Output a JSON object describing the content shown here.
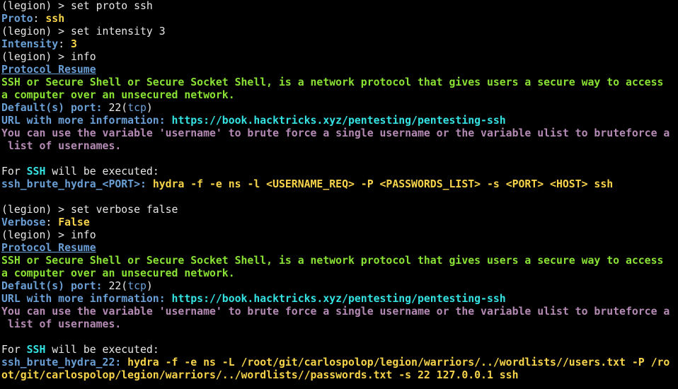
{
  "colors": {
    "background": "#000000",
    "foreground": "#e8e8e8",
    "blue": "#6a9fd6",
    "yellow": "#f7d44a",
    "green": "#8ae234",
    "cyan": "#34e2e2",
    "magenta": "#b58bb5"
  },
  "lines": [
    {
      "segments": [
        {
          "text": "(legion) > set proto ssh",
          "cls": "p-prompt"
        }
      ]
    },
    {
      "segments": [
        {
          "text": "Proto",
          "cls": "blue-b"
        },
        {
          "text": ": ",
          "cls": "white"
        },
        {
          "text": "ssh",
          "cls": "yellow-b"
        }
      ]
    },
    {
      "segments": [
        {
          "text": "(legion) > set intensity 3",
          "cls": "p-prompt"
        }
      ]
    },
    {
      "segments": [
        {
          "text": "Intensity",
          "cls": "blue-b"
        },
        {
          "text": ": ",
          "cls": "white"
        },
        {
          "text": "3",
          "cls": "yellow-b"
        }
      ]
    },
    {
      "segments": [
        {
          "text": "(legion) > info",
          "cls": "p-prompt"
        }
      ]
    },
    {
      "segments": [
        {
          "text": "Protocol Resume",
          "cls": "blue-b underline"
        }
      ]
    },
    {
      "segments": [
        {
          "text": "SSH or Secure Shell or Secure Socket Shell, is a network protocol that gives users a secure way to access",
          "cls": "green-b"
        }
      ]
    },
    {
      "segments": [
        {
          "text": "a computer over an unsecured network.",
          "cls": "green-b"
        }
      ]
    },
    {
      "segments": [
        {
          "text": "Default(s) port:",
          "cls": "blue-b"
        },
        {
          "text": " 22(",
          "cls": "white"
        },
        {
          "text": "tcp",
          "cls": "blue"
        },
        {
          "text": ")",
          "cls": "white"
        }
      ]
    },
    {
      "segments": [
        {
          "text": "URL with more information:",
          "cls": "blue-b"
        },
        {
          "text": " https://book.hacktricks.xyz/pentesting/pentesting-ssh",
          "cls": "cyan-b"
        }
      ]
    },
    {
      "segments": [
        {
          "text": "You can use the variable 'username' to brute force a single username or the variable ulist to bruteforce a",
          "cls": "magenta-b"
        }
      ]
    },
    {
      "segments": [
        {
          "text": " list of usernames.",
          "cls": "magenta-b"
        }
      ]
    },
    {
      "segments": [
        {
          "text": "",
          "cls": "white"
        }
      ]
    },
    {
      "segments": [
        {
          "text": "For ",
          "cls": "white"
        },
        {
          "text": "SSH",
          "cls": "cyan-b"
        },
        {
          "text": " will be executed:",
          "cls": "white"
        }
      ]
    },
    {
      "segments": [
        {
          "text": "ssh_brute_hydra_<PORT>:",
          "cls": "blue-b"
        },
        {
          "text": " hydra -f -e ns -l <USERNAME_REQ> -P <PASSWORDS_LIST> -s <PORT> <HOST> ssh",
          "cls": "yellow-b"
        }
      ]
    },
    {
      "segments": [
        {
          "text": "",
          "cls": "white"
        }
      ]
    },
    {
      "segments": [
        {
          "text": "(legion) > set verbose false",
          "cls": "p-prompt"
        }
      ]
    },
    {
      "segments": [
        {
          "text": "Verbose",
          "cls": "blue-b"
        },
        {
          "text": ": ",
          "cls": "white"
        },
        {
          "text": "False",
          "cls": "yellow-b"
        }
      ]
    },
    {
      "segments": [
        {
          "text": "(legion) > info",
          "cls": "p-prompt"
        }
      ]
    },
    {
      "segments": [
        {
          "text": "Protocol Resume",
          "cls": "blue-b underline"
        }
      ]
    },
    {
      "segments": [
        {
          "text": "SSH or Secure Shell or Secure Socket Shell, is a network protocol that gives users a secure way to access",
          "cls": "green-b"
        }
      ]
    },
    {
      "segments": [
        {
          "text": "a computer over an unsecured network.",
          "cls": "green-b"
        }
      ]
    },
    {
      "segments": [
        {
          "text": "Default(s) port:",
          "cls": "blue-b"
        },
        {
          "text": " 22(",
          "cls": "white"
        },
        {
          "text": "tcp",
          "cls": "blue"
        },
        {
          "text": ")",
          "cls": "white"
        }
      ]
    },
    {
      "segments": [
        {
          "text": "URL with more information:",
          "cls": "blue-b"
        },
        {
          "text": " https://book.hacktricks.xyz/pentesting/pentesting-ssh",
          "cls": "cyan-b"
        }
      ]
    },
    {
      "segments": [
        {
          "text": "You can use the variable 'username' to brute force a single username or the variable ulist to bruteforce a",
          "cls": "magenta-b"
        }
      ]
    },
    {
      "segments": [
        {
          "text": " list of usernames.",
          "cls": "magenta-b"
        }
      ]
    },
    {
      "segments": [
        {
          "text": "",
          "cls": "white"
        }
      ]
    },
    {
      "segments": [
        {
          "text": "For ",
          "cls": "white"
        },
        {
          "text": "SSH",
          "cls": "cyan-b"
        },
        {
          "text": " will be executed:",
          "cls": "white"
        }
      ]
    },
    {
      "segments": [
        {
          "text": "ssh_brute_hydra_22:",
          "cls": "blue-b"
        },
        {
          "text": " hydra -f -e ns -L /root/git/carlospolop/legion/warriors/../wordlists//users.txt -P /ro",
          "cls": "yellow-b"
        }
      ]
    },
    {
      "segments": [
        {
          "text": "ot/git/carlospolop/legion/warriors/../wordlists//passwords.txt -s 22 127.0.0.1 ssh",
          "cls": "yellow-b"
        }
      ]
    }
  ]
}
